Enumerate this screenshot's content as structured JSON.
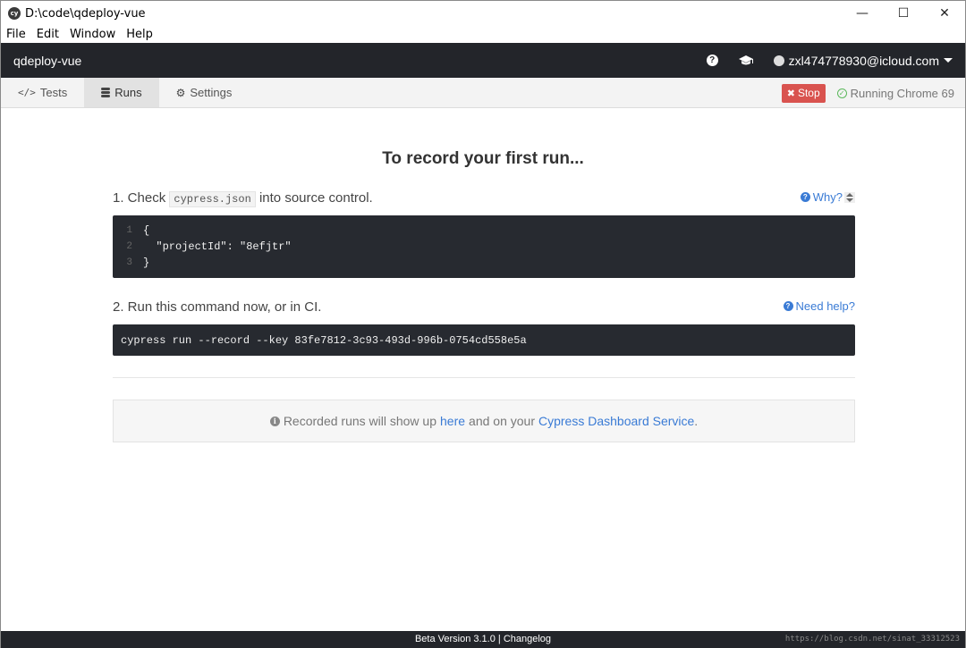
{
  "window": {
    "title": "D:\\code\\qdeploy-vue",
    "app_icon_text": "cy",
    "minimize": "—",
    "maximize": "☐",
    "close": "✕"
  },
  "menu": [
    "File",
    "Edit",
    "Window",
    "Help"
  ],
  "header": {
    "project_name": "qdeploy-vue",
    "help_icon": "?",
    "docs_icon": "graduation-cap-icon",
    "user_email": "zxl474778930@icloud.com"
  },
  "nav": {
    "tabs": [
      {
        "label": "Tests",
        "icon": "</>"
      },
      {
        "label": "Runs",
        "icon": "database-icon"
      },
      {
        "label": "Settings",
        "icon": "⚙"
      }
    ],
    "stop_label": "Stop",
    "running_label": "Running Chrome 69"
  },
  "main": {
    "title": "To record your first run...",
    "step1": {
      "prefix": "1. Check",
      "file": "cypress.json",
      "suffix": "into source control.",
      "help": "Why?"
    },
    "code_lines": [
      {
        "n": "1",
        "text": "{"
      },
      {
        "n": "2",
        "text": "  \"projectId\": \"8efjtr\""
      },
      {
        "n": "3",
        "text": "}"
      }
    ],
    "step2": {
      "text": "2. Run this command now, or in CI.",
      "help": "Need help?"
    },
    "command": "cypress run --record --key 83fe7812-3c93-493d-996b-0754cd558e5a",
    "notice": {
      "text1": "Recorded runs will show up",
      "link1": "here",
      "text2": "and on your",
      "link2": "Cypress Dashboard Service",
      "end": "."
    }
  },
  "footer": {
    "version": "Beta Version 3.1.0 | Changelog"
  },
  "watermark": "https://blog.csdn.net/sinat_33312523",
  "colors": {
    "header_bg": "#23252a",
    "stop": "#d9534f",
    "link": "#3a7bd5",
    "running_ok": "#5cb85c"
  }
}
